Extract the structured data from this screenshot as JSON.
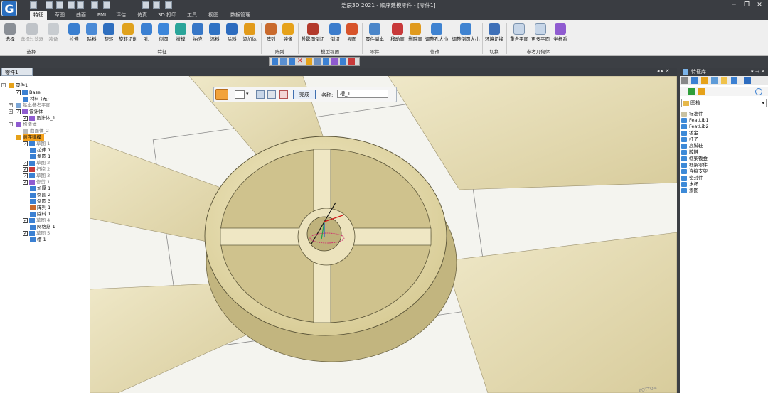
{
  "app": {
    "title": "浩辰3D 2021 - 顺序建模零件 - [零件1]"
  },
  "tabs": [
    "特征",
    "草图",
    "曲面",
    "PMI",
    "评估",
    "仿真",
    "3D 打印",
    "工具",
    "视图",
    "数据管理"
  ],
  "ribbon": {
    "buttons": [
      "选择",
      "选择过滤器",
      "装备",
      "拉伸",
      "除料",
      "旋转",
      "旋转切削",
      "孔",
      "倒圆",
      "拔模",
      "抽壳",
      "添料",
      "除料",
      "添加体",
      "阵列",
      "镜像",
      "投影面倒切",
      "倒切",
      "视图",
      "零件副本",
      "移动面",
      "删除面",
      "调整孔大小",
      "调整倒圆大小",
      "环境切换",
      "重合平面",
      "更多平面",
      "坐标系"
    ],
    "groups": [
      "选择",
      "特征",
      "阵列",
      "模型视图",
      "零件",
      "修改",
      "切换",
      "参考几何体"
    ]
  },
  "doc_tab": "零件1",
  "feature_toolbar": {
    "done_label": "完成",
    "name_label": "名称:",
    "name_value": "槽_1"
  },
  "tree": [
    "零件1",
    "Base",
    "材料 (无)",
    "基本参考平面",
    "设计体",
    "设计体_1",
    "构造体",
    "曲面体_2",
    "顺序建模",
    "草图 1",
    "拉伸 1",
    "倒圆 1",
    "草图 2",
    "扫掠 2",
    "草图 3",
    "修剪 1",
    "加厚 1",
    "倒圆 2",
    "倒圆 3",
    "阵列 1",
    "除料 1",
    "草图 4",
    "网格筋 1",
    "草图 5",
    "槽 1"
  ],
  "library": {
    "title": "特征库",
    "path": "图档",
    "items": [
      "标准件",
      "FeatLib1",
      "FeatLib2",
      "钣金",
      "杆子",
      "高脚鞋",
      "胶鞋",
      "框架钣金",
      "框架零件",
      "连接支架",
      "密封件",
      "水杯",
      "渗图"
    ]
  },
  "viewport_label": "BOTTOM"
}
